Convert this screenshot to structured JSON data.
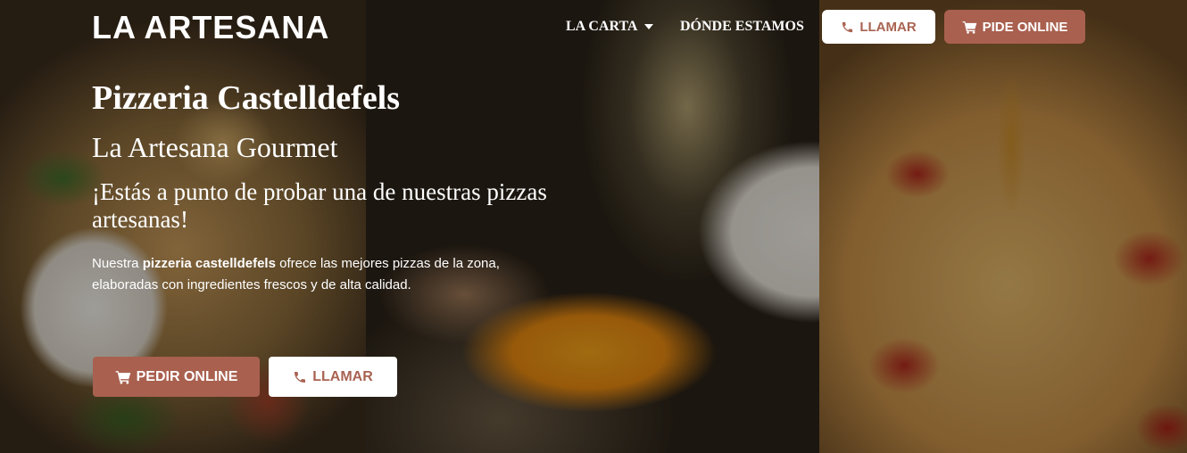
{
  "brand": {
    "logo_text": "LA ARTESANA"
  },
  "nav": {
    "items": [
      {
        "label": "LA CARTA",
        "has_dropdown": true
      },
      {
        "label": "DÓNDE ESTAMOS",
        "has_dropdown": false
      }
    ],
    "call_button": {
      "label": "LLAMAR",
      "icon": "phone-icon"
    },
    "order_button": {
      "label": "PIDE ONLINE",
      "icon": "cart-icon"
    }
  },
  "hero": {
    "title": "Pizzeria Castelldefels",
    "subtitle": "La Artesana Gourmet",
    "tagline": "¡Estás a punto de probar una de nuestras pizzas artesanas!",
    "description": {
      "before": "Nuestra ",
      "bold": "pizzeria castelldefels",
      "after": " ofrece las mejores pizzas de la zona, elaboradas con ingredientes frescos y de alta calidad."
    },
    "order_button": {
      "label": "PEDIR ONLINE",
      "icon": "cart-icon"
    },
    "call_button": {
      "label": "LLAMAR",
      "icon": "phone-icon"
    }
  },
  "colors": {
    "accent": "#a9604f",
    "accent_text": "#a96352",
    "white": "#ffffff"
  }
}
